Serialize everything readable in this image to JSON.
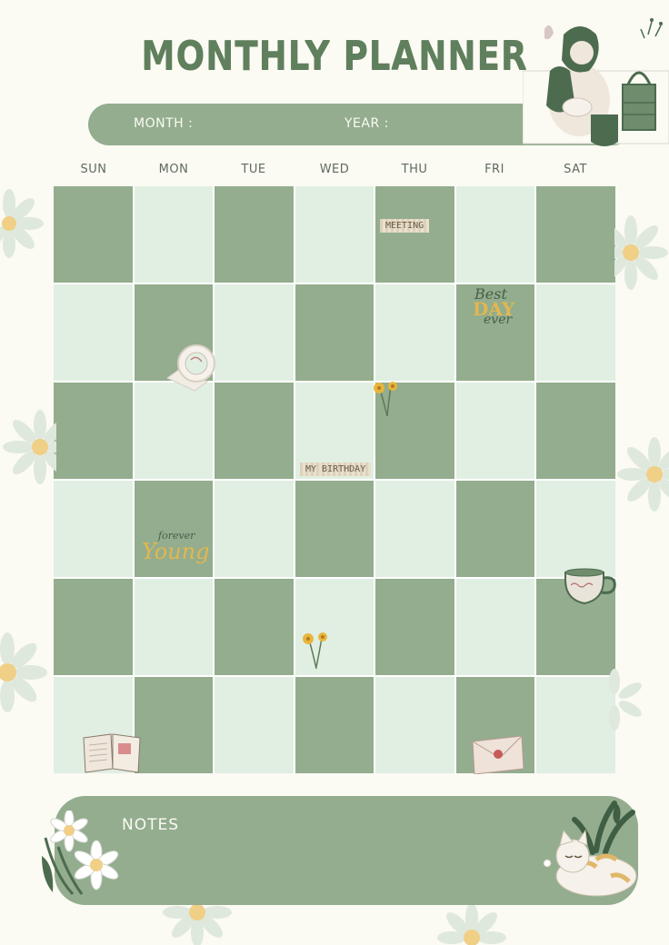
{
  "title": "MONTHLY PLANNER",
  "header": {
    "month_label": "MONTH :",
    "year_label": "YEAR :"
  },
  "weekdays": [
    "SUN",
    "MON",
    "TUE",
    "WED",
    "THU",
    "FRI",
    "SAT"
  ],
  "calendar": {
    "rows": 6,
    "cols": 7,
    "dark_color": "#93ad8e",
    "light_color": "#e1efe3",
    "pattern": "checkerboard-dark-first"
  },
  "stickers": {
    "meeting": "MEETING",
    "birthday": "MY BIRTHDAY",
    "best_day_line1": "Best",
    "best_day_line2": "DAY",
    "best_day_line3": "ever",
    "forever": "forever",
    "young": "Young"
  },
  "notes": {
    "label": "NOTES"
  },
  "colors": {
    "background": "#fbfaf3",
    "accent_green": "#93ad8e",
    "title_green": "#5f7f5d",
    "sticker_yellow": "#e2b74e"
  }
}
